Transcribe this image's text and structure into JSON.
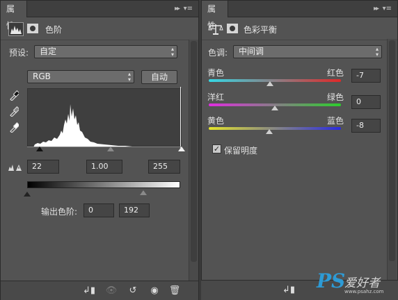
{
  "left_panel": {
    "tab_label": "属性",
    "tab_expand": "▸▸",
    "tab_menu": "▾≡",
    "title": "色阶",
    "preset": {
      "label": "预设:",
      "value": "自定"
    },
    "channel": {
      "value": "RGB"
    },
    "auto_button": "自动",
    "input_levels": {
      "black": "22",
      "gamma": "1.00",
      "white": "255"
    },
    "output": {
      "label": "输出色阶:",
      "low": "0",
      "high": "192"
    }
  },
  "right_panel": {
    "tab_label": "属性",
    "tab_expand": "▸▸",
    "tab_menu": "▾≡",
    "title": "色彩平衡",
    "tone": {
      "label": "色调:",
      "value": "中间调"
    },
    "sliders": [
      {
        "left": "青色",
        "right": "红色",
        "value": "-7",
        "gradient": [
          "#35d7e4",
          "#e02828"
        ]
      },
      {
        "left": "洋红",
        "right": "绿色",
        "value": "0",
        "gradient": [
          "#e02de0",
          "#2cce2c"
        ]
      },
      {
        "left": "黄色",
        "right": "蓝色",
        "value": "-8",
        "gradient": [
          "#e4e42a",
          "#2a2ae0"
        ]
      }
    ],
    "preserve_luminosity": {
      "label": "保留明度",
      "checked": true
    }
  },
  "watermark": {
    "brand": "PS",
    "cn": "爱好者",
    "url": "www.psahz.com"
  },
  "colors": {
    "panel": "#535353",
    "tab_bar": "#3f3f3f",
    "field": "#454545"
  }
}
